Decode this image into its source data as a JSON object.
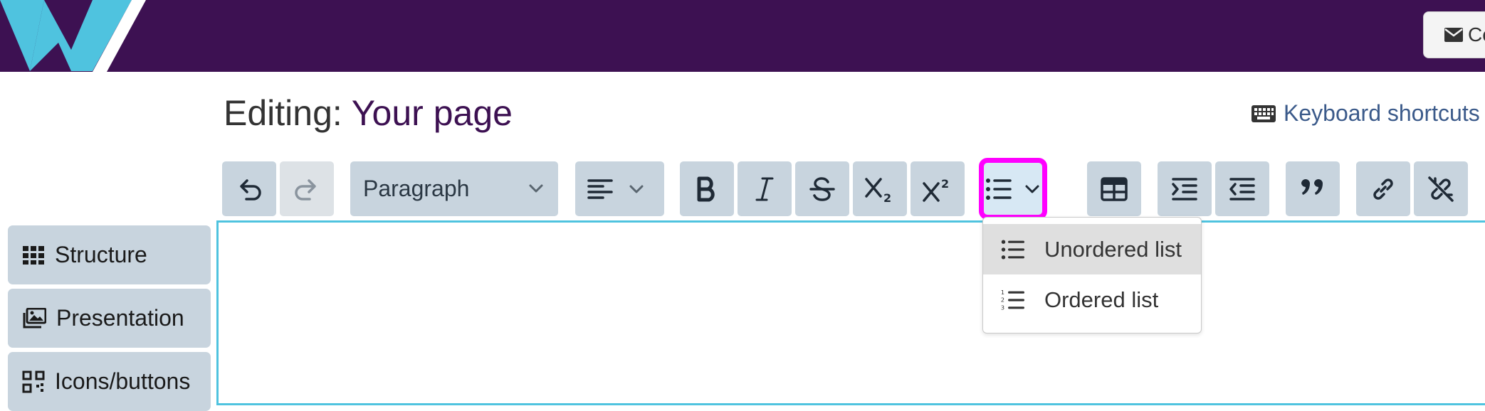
{
  "header": {
    "contact_label": "Co"
  },
  "title": {
    "prefix": "Editing:",
    "page_name": "Your page"
  },
  "shortcuts": {
    "label": "Keyboard shortcuts"
  },
  "toolbar": {
    "block_format": "Paragraph"
  },
  "sidebar": {
    "items": [
      {
        "label": "Structure"
      },
      {
        "label": "Presentation"
      },
      {
        "label": "Icons/buttons"
      }
    ]
  },
  "list_menu": {
    "items": [
      {
        "label": "Unordered list"
      },
      {
        "label": "Ordered list"
      }
    ]
  },
  "colors": {
    "header_bg": "#3d1152",
    "logo": "#4fc3df",
    "toolbar_btn": "#c8d4de",
    "highlight": "#ff00ff",
    "accent_text": "#3d1152"
  }
}
